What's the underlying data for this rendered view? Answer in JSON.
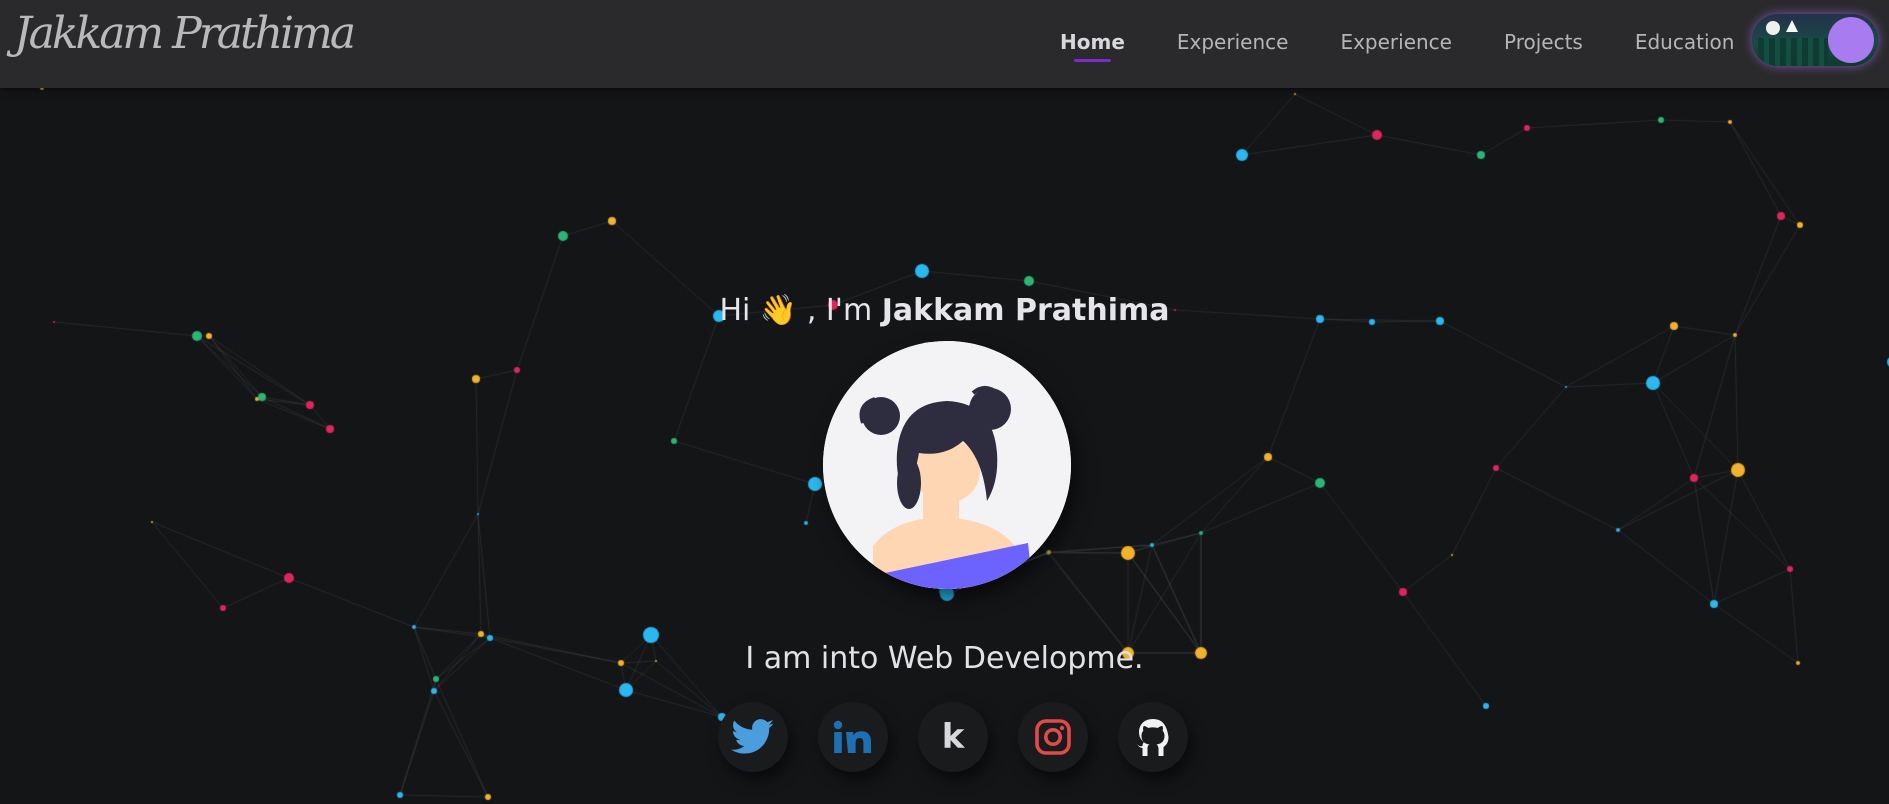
{
  "header": {
    "logo_text": "Jakkam Prathima",
    "nav": [
      {
        "label": "Home",
        "active": true
      },
      {
        "label": "Experience",
        "active": false
      },
      {
        "label": "Experience",
        "active": false
      },
      {
        "label": "Projects",
        "active": false
      },
      {
        "label": "Education",
        "active": false
      }
    ],
    "theme_toggle_icon": "night-scene-toggle-icon"
  },
  "hero": {
    "greeting_prefix": "Hi",
    "greeting_emoji": "👋",
    "greeting_mid": ", I'm",
    "name": "Jakkam Prathima",
    "tagline": "I am into Web Developme."
  },
  "socials": [
    {
      "name": "twitter",
      "icon": "twitter-icon",
      "color": "#4a9ede"
    },
    {
      "name": "linkedin",
      "icon": "linkedin-icon",
      "color": "#1f6fb3"
    },
    {
      "name": "kaggle",
      "icon": "kaggle-icon",
      "color": "#d8d8dc"
    },
    {
      "name": "instagram",
      "icon": "instagram-icon",
      "color": "#e24a4a"
    },
    {
      "name": "github",
      "icon": "github-icon",
      "color": "#f2f2f2"
    }
  ],
  "colors": {
    "background": "#141517",
    "header": "#2a2a2c",
    "accent": "#7a2dc8",
    "particle_palette": [
      "#e0245e",
      "#f2b22a",
      "#2bb673",
      "#2ab8f0"
    ]
  }
}
